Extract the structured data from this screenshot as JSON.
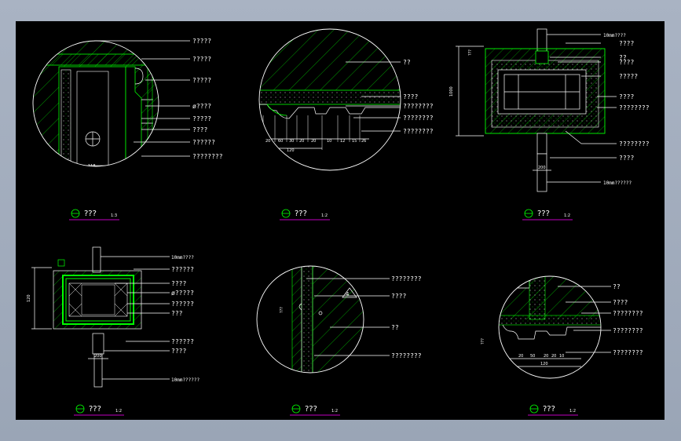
{
  "details": [
    {
      "id": "d1",
      "labels": [
        "?????",
        "?????",
        "?????",
        "ø????",
        "?????",
        "????",
        "??????",
        "????????"
      ],
      "title": "???",
      "scale": "1:3"
    },
    {
      "id": "d2",
      "labels": [
        "??",
        "????",
        "????????",
        "????????",
        "????????"
      ],
      "title": "???",
      "scale": "1:2",
      "dims": [
        "20",
        "60",
        "30",
        "20",
        "20",
        "10",
        "12",
        "15",
        "26"
      ],
      "total": "120"
    },
    {
      "id": "d3",
      "labels": [
        "10mm????",
        "????",
        "??",
        "????",
        "?????",
        "????",
        "????????",
        "????????",
        "????",
        "10mm??????"
      ],
      "title": "???",
      "scale": "1:2",
      "side_text": "???",
      "height_dim": "1000",
      "bottom_dim": "200"
    },
    {
      "id": "d4",
      "labels": [
        "10mm????",
        "??????",
        "????",
        "ø?????",
        "??????",
        "???",
        "??????",
        "????",
        "10mm??????"
      ],
      "title": "???",
      "scale": "1:2",
      "height_dim": "120",
      "bottom_dim": "200"
    },
    {
      "id": "d5",
      "labels": [
        "????????",
        "????",
        "??",
        "????????"
      ],
      "title": "???",
      "scale": "1:2",
      "side_text": "???",
      "marker": "4"
    },
    {
      "id": "d6",
      "labels": [
        "??",
        "????",
        "????????",
        "????????",
        "????????"
      ],
      "title": "???",
      "scale": "1:2",
      "side_text": "???",
      "dims": [
        "20",
        "50",
        "20",
        "20",
        "10"
      ],
      "total": "120"
    }
  ]
}
